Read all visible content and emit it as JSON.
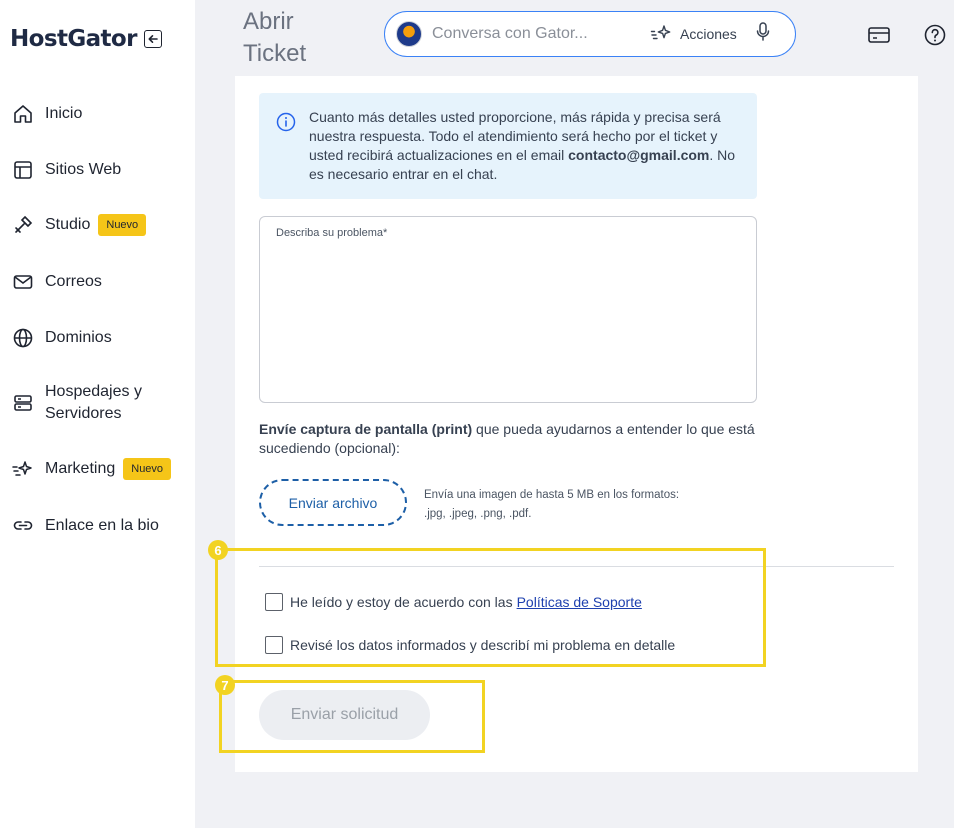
{
  "brand": {
    "logo_text": "HostGator"
  },
  "sidebar": {
    "items": [
      {
        "label": "Inicio",
        "icon": "home-icon"
      },
      {
        "label": "Sitios Web",
        "icon": "website-icon"
      },
      {
        "label": "Studio",
        "icon": "studio-icon",
        "badge": "Nuevo"
      },
      {
        "label": "Correos",
        "icon": "mail-icon"
      },
      {
        "label": "Dominios",
        "icon": "globe-icon"
      },
      {
        "label_line1": "Hospedajes y",
        "label_line2": "Servidores",
        "icon": "server-icon"
      },
      {
        "label": "Marketing",
        "icon": "sparkle-icon",
        "badge": "Nuevo"
      },
      {
        "label": "Enlace en la bio",
        "icon": "link-icon"
      }
    ]
  },
  "header": {
    "title_line1": "Abrir",
    "title_line2": "Ticket",
    "search": {
      "placeholder": "Conversa con Gator...",
      "actions_label": "Acciones"
    }
  },
  "form": {
    "info": {
      "text_before": "Cuanto más detalles usted proporcione, más rápida y precisa será nuestra respuesta. Todo el atendimiento será hecho por el ticket y usted recibirá actualizaciones en el email ",
      "email": "contacto@gmail.com",
      "text_after": ". No es necesario entrar en el chat."
    },
    "description_label": "Describa su problema*",
    "screenshot_bold": "Envíe captura de pantalla (print)",
    "screenshot_rest": " que pueda ayudarnos a entender lo que está sucediendo (opcional):",
    "upload_label": "Enviar archivo",
    "upload_hint_line1": "Envía una imagen de hasta 5 MB en los formatos:",
    "upload_hint_line2": ".jpg, .jpeg, .png, .pdf.",
    "checkbox1_text": "He leído y estoy de acuerdo con las",
    "checkbox1_link": "Políticas de Soporte",
    "checkbox2_text": "Revisé los datos informados y describí mi problema en detalle",
    "submit_label": "Enviar solicitud"
  },
  "annotations": {
    "marker_6": "6",
    "marker_7": "7"
  },
  "colors": {
    "highlight": "#f2d322",
    "accent_blue": "#1d5fa7",
    "info_bg": "#e6f3fc",
    "badge": "#f5c518"
  }
}
